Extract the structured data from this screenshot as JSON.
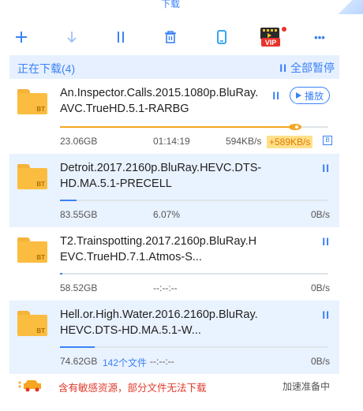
{
  "window": {
    "title": "下载"
  },
  "toolbar": {
    "icons": [
      "plus-icon",
      "download-arrow-icon",
      "pause-icon",
      "trash-icon",
      "phone-icon",
      "vip-icon",
      "more-icon"
    ],
    "vip_label": "VIP",
    "more_label": "•••",
    "accent": "#3b82f6"
  },
  "section": {
    "label": "正在下载(4)",
    "pause_all_bars": "II",
    "pause_all_label": "全部暂停"
  },
  "items": [
    {
      "name": "An.Inspector.Calls.2015.1080p.BluRay.AVC.TrueHD.5.1-RARBG",
      "icon_label": "BT",
      "pause": "II",
      "play_label": "播放",
      "progress": 0.88,
      "size": "23.06GB",
      "time": "01:14:19",
      "speed": "594KB/s",
      "boost": "+589KB/s",
      "boost_icon": "B"
    },
    {
      "name": "Detroit.2017.2160p.BluRay.HEVC.DTS-HD.MA.5.1-PRECELL",
      "icon_label": "BT",
      "pause": "II",
      "progress": 0.0607,
      "size": "83.55GB",
      "percent": "6.07%",
      "speed": "0B/s"
    },
    {
      "name": "T2.Trainspotting.2017.2160p.BluRay.HEVC.TrueHD.7.1.Atmos-S...",
      "icon_label": "BT",
      "pause": "II",
      "progress": 0.01,
      "size": "58.52GB",
      "time": "--:--:--",
      "speed": "0B/s"
    },
    {
      "name": "Hell.or.High.Water.2016.2160p.BluRay.HEVC.DTS-HD.MA.5.1-W...",
      "icon_label": "BT",
      "pause": "II",
      "progress": 0.13,
      "size": "74.62GB",
      "files": "142个文件",
      "time": "--:--:--",
      "speed": "0B/s"
    }
  ],
  "footer": {
    "warning": "含有敏感资源，部分文件无法下载",
    "accel_status": "加速准备中"
  }
}
